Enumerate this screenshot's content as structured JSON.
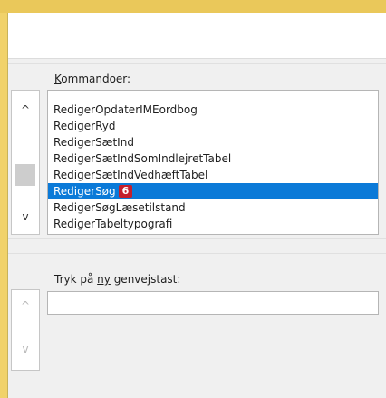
{
  "commands_label_prefix": "",
  "commands_label_accel": "K",
  "commands_label_rest": "ommandoer:",
  "commands": [
    "RedigerOpdaterIMEordbog",
    "RedigerRyd",
    "RedigerSætInd",
    "RedigerSætIndSomIndlejretTabel",
    "RedigerSætIndVedhæftTabel",
    "RedigerSøg",
    "RedigerSøgLæsetilstand",
    "RedigerTabeltypografi"
  ],
  "selected_index": 5,
  "step_badge": "6",
  "shortcut_label_prefix": "Tryk på ",
  "shortcut_label_accel": "ny",
  "shortcut_label_rest": " genvejstast:",
  "shortcut_input_value": "",
  "icons": {
    "scroll_up": "▲",
    "scroll_down": "▼",
    "up_chevron": "⌃",
    "down_chevron": "⌄"
  },
  "colors": {
    "selection": "#0b7ad8",
    "badge": "#c41f2d",
    "frame": "#f1d26a"
  }
}
